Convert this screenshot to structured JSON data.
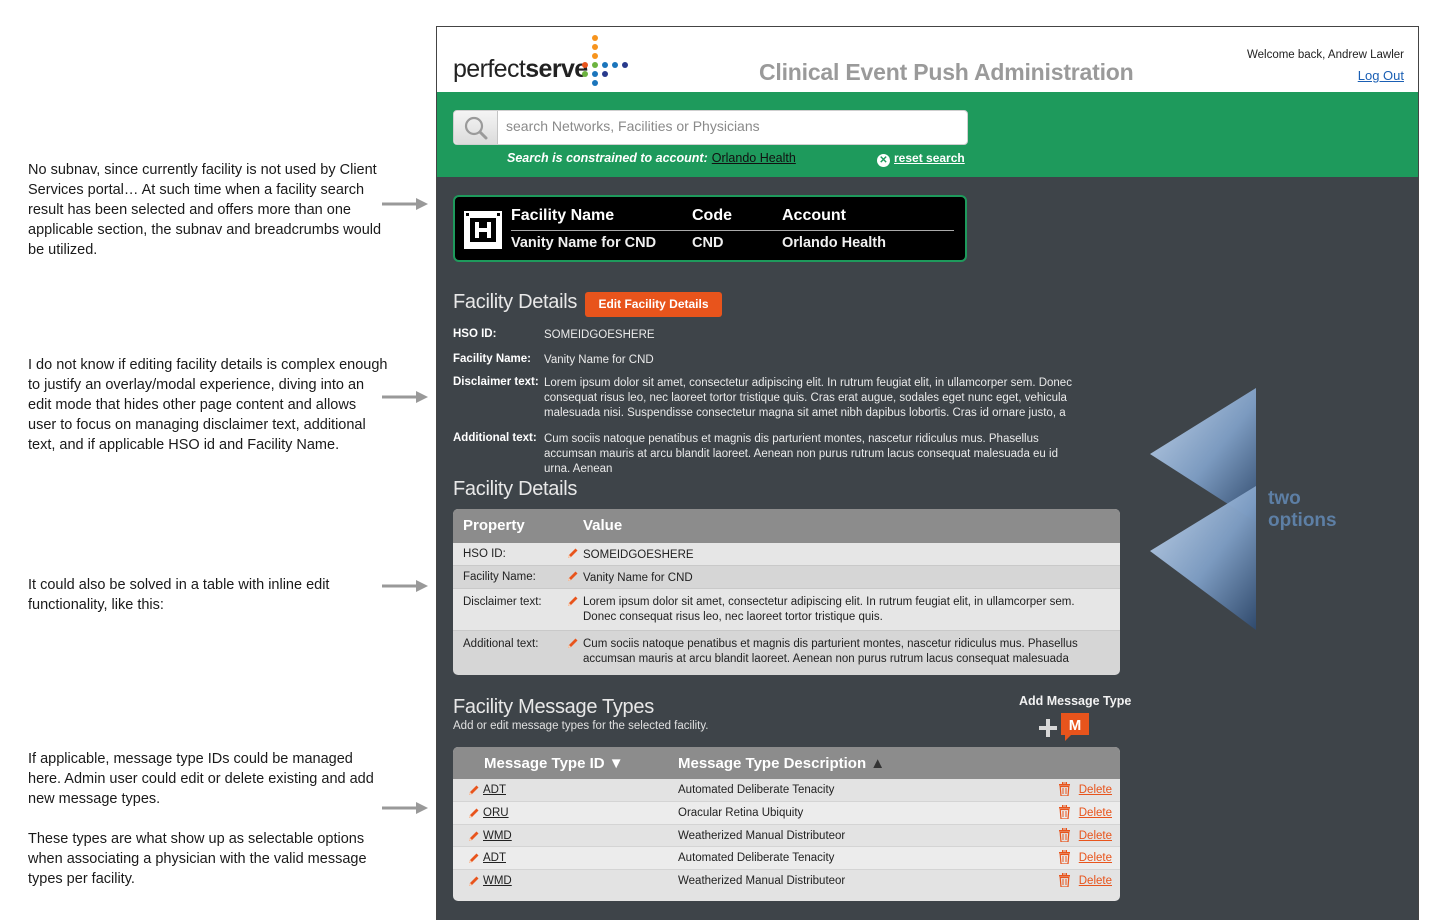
{
  "annotations": {
    "subnav": "No subnav, since currently facility is not used by Client Services portal… At such time when a facility search result has been selected and offers more than one  applicable section, the subnav and breadcrumbs would be utilized.",
    "editing": "I do not know if editing facility details is complex enough to justify an overlay/modal experience, diving into an edit mode that hides other page content and allows user to focus on managing disclaimer text, additional text, and if applicable HSO id and Facility Name.",
    "table": "It could also be solved in a table with inline edit functionality, like this:",
    "message_types_1": "If applicable, message type IDs could be managed here.  Admin user could edit or delete existing and add new message types.",
    "message_types_2": "These types are what show up as selectable options when associating a physician with the valid message types per facility.",
    "two_options": "two options"
  },
  "header": {
    "logo_light": "perfect",
    "logo_bold": "serve",
    "title": "Clinical Event Push Administration",
    "welcome": "Welcome back, Andrew Lawler",
    "logout": "Log Out"
  },
  "search": {
    "placeholder": "search Networks, Facilities or Physicians",
    "constraint_label": "Search is constrained to account:",
    "constraint_account": "Orlando Health",
    "reset": "reset search"
  },
  "facility_card": {
    "headers": {
      "name": "Facility Name",
      "code": "Code",
      "account": "Account"
    },
    "values": {
      "name": "Vanity Name for CND",
      "code": "CND",
      "account": "Orlando Health"
    }
  },
  "details": {
    "title": "Facility Details",
    "edit_button": "Edit Facility Details",
    "rows": [
      {
        "label": "HSO ID:",
        "value": "SOMEIDGOESHERE"
      },
      {
        "label": "Facility Name:",
        "value": "Vanity Name for CND"
      },
      {
        "label": "Disclaimer text:",
        "value": "Lorem ipsum dolor sit amet, consectetur adipiscing elit. In rutrum feugiat elit, in ullamcorper sem. Donec consequat risus leo, nec laoreet tortor tristique quis. Cras erat augue, sodales eget nunc eget, vehicula malesuada nisi. Suspendisse consectetur magna sit amet nibh dapibus lobortis. Cras id ornare justo, a"
      },
      {
        "label": "Additional text:",
        "value": "Cum sociis natoque penatibus et magnis dis parturient montes, nascetur ridiculus mus. Phasellus accumsan mauris at arcu blandit laoreet. Aenean non purus rutrum lacus consequat malesuada eu id urna. Aenean"
      }
    ]
  },
  "details_table": {
    "title": "Facility Details",
    "col_property": "Property",
    "col_value": "Value",
    "rows": [
      {
        "label": "HSO ID:",
        "value": "SOMEIDGOESHERE"
      },
      {
        "label": "Facility Name:",
        "value": "Vanity Name for CND"
      },
      {
        "label": "Disclaimer text:",
        "value": "Lorem ipsum dolor sit amet, consectetur adipiscing elit. In rutrum feugiat elit, in ullamcorper sem. Donec consequat risus leo, nec laoreet tortor tristique quis."
      },
      {
        "label": "Additional text:",
        "value": "Cum sociis natoque penatibus et magnis dis parturient montes, nascetur ridiculus mus. Phasellus accumsan mauris at arcu blandit laoreet. Aenean non purus rutrum lacus consequat malesuada"
      }
    ]
  },
  "message_types": {
    "title": "Facility Message Types",
    "subtitle": "Add or edit message types for the selected facility.",
    "add_label": "Add Message Type",
    "add_icon_letter": "M",
    "col_id": "Message Type ID",
    "col_desc": "Message Type Description",
    "delete_label": "Delete",
    "rows": [
      {
        "id": "ADT",
        "desc": "Automated Deliberate Tenacity"
      },
      {
        "id": "ORU",
        "desc": "Oracular Retina Ubiquity"
      },
      {
        "id": "WMD",
        "desc": "Weatherized Manual Distributeor"
      },
      {
        "id": "ADT",
        "desc": "Automated Deliberate Tenacity"
      },
      {
        "id": "WMD",
        "desc": "Weatherized Manual Distributeor"
      }
    ]
  },
  "colors": {
    "brand_green": "#1e9a5c",
    "accent_orange": "#e8541c",
    "panel_dark": "#3e4449"
  }
}
